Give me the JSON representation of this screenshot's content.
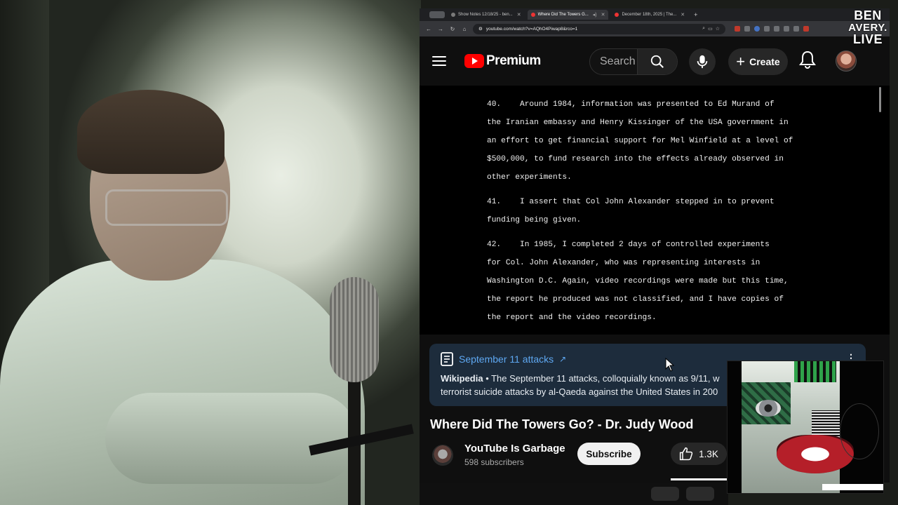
{
  "overlay": {
    "logo_line1": "BEN",
    "logo_line2": "AVERY.",
    "logo_line3": "LIVE"
  },
  "browser": {
    "tabs": [
      {
        "label": "Show Notes 12/18/25 - ben...",
        "active": false
      },
      {
        "label": "Where Did The Towers G...",
        "active": true
      },
      {
        "label": "December 18th, 2025 | The...",
        "active": false
      }
    ],
    "url": "youtube.com/watch?v=AQhO4Piwap8&rco=1"
  },
  "youtube": {
    "logo_text": "Premium",
    "search_placeholder": "Search",
    "create_label": "Create",
    "document": [
      {
        "lines": [
          "40.    Around 1984, information was presented to Ed Murand of",
          "the Iranian embassy and Henry Kissinger of the USA government in",
          "an effort to get financial support for Mel Winfield at a level of",
          "$500,000, to fund research into the effects already observed in",
          "other experiments."
        ]
      },
      {
        "lines": [
          "41.    I assert that Col John Alexander stepped in to prevent",
          "funding being given."
        ]
      },
      {
        "lines": [
          "42.    In 1985, I completed 2 days of controlled experiments",
          "for Col. John Alexander, who was representing interests in",
          "Washington D.C. Again, video recordings were made but this time,",
          "the report he produced was not classified, and I have copies of",
          "the report and the video recordings."
        ]
      }
    ],
    "wiki_card": {
      "title": "September 11 attacks",
      "arrow": "↗",
      "source": "Wikipedia",
      "line1": " • The September 11 attacks, colloquially known as 9/11, w",
      "line2": "terrorist suicide attacks by al-Qaeda against the United States in 200"
    },
    "video_title": "Where Did The Towers Go? - Dr. Judy Wood",
    "channel_name": "YouTube Is Garbage",
    "subscribers": "598 subscribers",
    "subscribe_label": "Subscribe",
    "like_count": "1.3K"
  },
  "colors": {
    "yt_red": "#ff0000",
    "link_blue": "#5ea8f2",
    "card_bg": "#1d2c3c"
  }
}
